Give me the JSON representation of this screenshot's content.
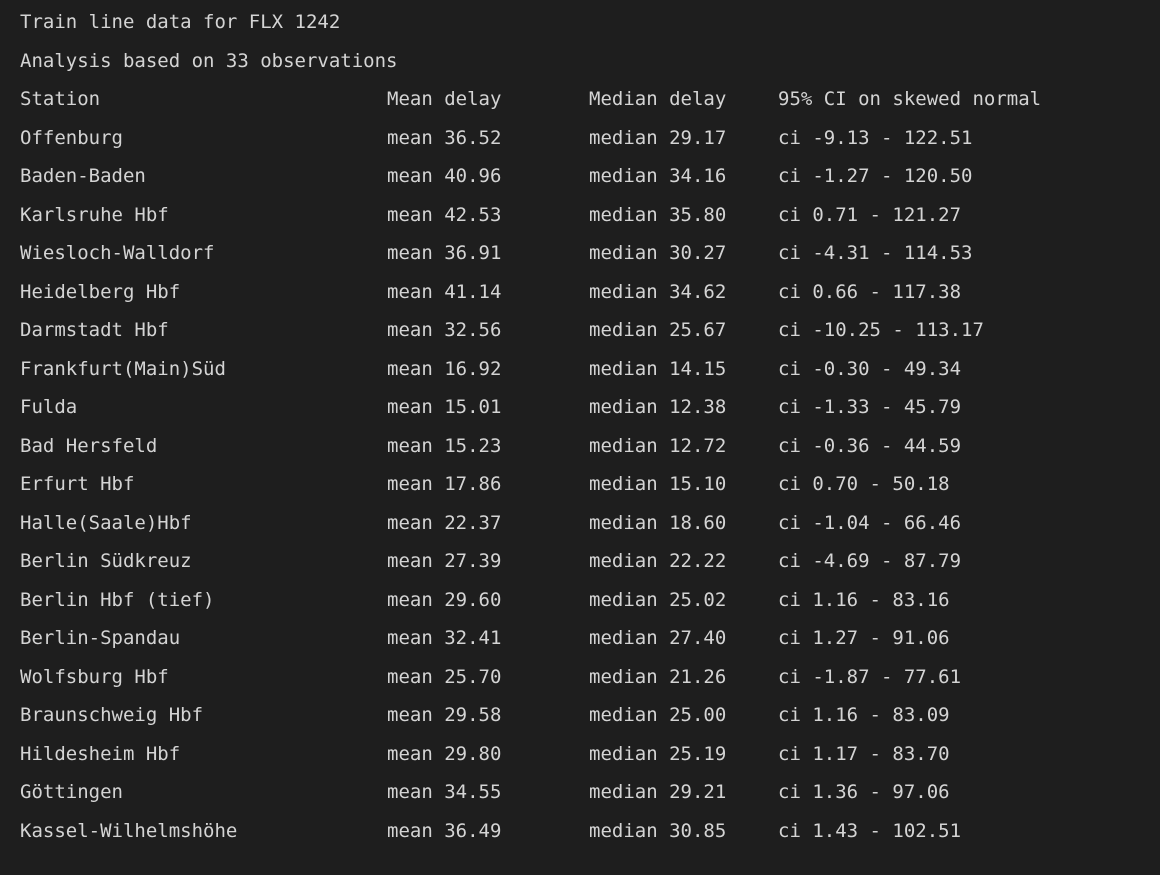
{
  "title": "Train line data for FLX 1242",
  "subtitle": "Analysis based on 33 observations",
  "columns": [
    "Station",
    "Mean delay",
    "Median delay",
    "95% CI on skewed normal"
  ],
  "rows": [
    {
      "station": "Offenburg",
      "mean": "mean 36.52",
      "median": "median 29.17",
      "ci": "ci -9.13 - 122.51"
    },
    {
      "station": "Baden-Baden",
      "mean": "mean 40.96",
      "median": "median 34.16",
      "ci": "ci -1.27 - 120.50"
    },
    {
      "station": "Karlsruhe Hbf",
      "mean": "mean 42.53",
      "median": "median 35.80",
      "ci": "ci 0.71 - 121.27"
    },
    {
      "station": "Wiesloch-Walldorf",
      "mean": "mean 36.91",
      "median": "median 30.27",
      "ci": "ci -4.31 - 114.53"
    },
    {
      "station": "Heidelberg Hbf",
      "mean": "mean 41.14",
      "median": "median 34.62",
      "ci": "ci 0.66 - 117.38"
    },
    {
      "station": "Darmstadt Hbf",
      "mean": "mean 32.56",
      "median": "median 25.67",
      "ci": "ci -10.25 - 113.17"
    },
    {
      "station": "Frankfurt(Main)Süd",
      "mean": "mean 16.92",
      "median": "median 14.15",
      "ci": "ci -0.30 - 49.34"
    },
    {
      "station": "Fulda",
      "mean": "mean 15.01",
      "median": "median 12.38",
      "ci": "ci -1.33 - 45.79"
    },
    {
      "station": "Bad Hersfeld",
      "mean": "mean 15.23",
      "median": "median 12.72",
      "ci": "ci -0.36 - 44.59"
    },
    {
      "station": "Erfurt Hbf",
      "mean": "mean 17.86",
      "median": "median 15.10",
      "ci": "ci 0.70 - 50.18"
    },
    {
      "station": "Halle(Saale)Hbf",
      "mean": "mean 22.37",
      "median": "median 18.60",
      "ci": "ci -1.04 - 66.46"
    },
    {
      "station": "Berlin Südkreuz",
      "mean": "mean 27.39",
      "median": "median 22.22",
      "ci": "ci -4.69 - 87.79"
    },
    {
      "station": "Berlin Hbf (tief)",
      "mean": "mean 29.60",
      "median": "median 25.02",
      "ci": "ci 1.16 - 83.16"
    },
    {
      "station": "Berlin-Spandau",
      "mean": "mean 32.41",
      "median": "median 27.40",
      "ci": "ci 1.27 - 91.06"
    },
    {
      "station": "Wolfsburg Hbf",
      "mean": "mean 25.70",
      "median": "median 21.26",
      "ci": "ci -1.87 - 77.61"
    },
    {
      "station": "Braunschweig Hbf",
      "mean": "mean 29.58",
      "median": "median 25.00",
      "ci": "ci 1.16 - 83.09"
    },
    {
      "station": "Hildesheim Hbf",
      "mean": "mean 29.80",
      "median": "median 25.19",
      "ci": "ci 1.17 - 83.70"
    },
    {
      "station": "Göttingen",
      "mean": "mean 34.55",
      "median": "median 29.21",
      "ci": "ci 1.36 - 97.06"
    },
    {
      "station": "Kassel-Wilhelmshöhe",
      "mean": "mean 36.49",
      "median": "median 30.85",
      "ci": "ci 1.43 - 102.51"
    }
  ]
}
